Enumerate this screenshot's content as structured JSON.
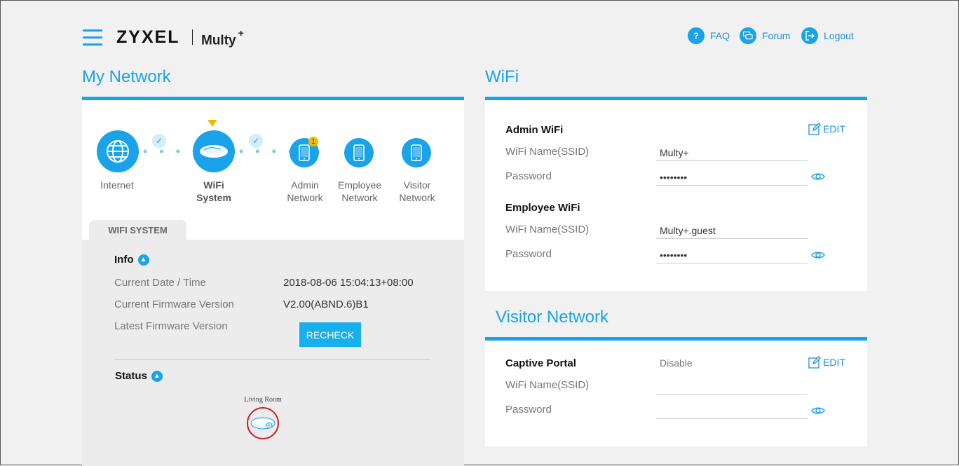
{
  "header": {
    "brand": "ZYXEL",
    "product": "Multy",
    "product_sup": "+",
    "links": [
      {
        "label": "FAQ",
        "icon": "faq-icon"
      },
      {
        "label": "Forum",
        "icon": "forum-icon"
      },
      {
        "label": "Logout",
        "icon": "logout-icon"
      }
    ]
  },
  "my_network": {
    "title": "My Network",
    "nodes": {
      "internet": "Internet",
      "wifi_system_line1": "WiFi",
      "wifi_system_line2": "System",
      "admin_line1": "Admin",
      "admin_line2": "Network",
      "admin_badge": "1",
      "employee_line1": "Employee",
      "employee_line2": "Network",
      "visitor_line1": "Visitor",
      "visitor_line2": "Network"
    },
    "tab": "WIFI SYSTEM",
    "info": {
      "heading": "Info",
      "date_label": "Current Date / Time",
      "date_value": "2018-08-06 15:04:13+08:00",
      "fw_label": "Current Firmware Version",
      "fw_value": "V2.00(ABND.6)B1",
      "latest_label": "Latest Firmware Version",
      "recheck": "RECHECK"
    },
    "status": {
      "heading": "Status",
      "device_label": "Living Room"
    }
  },
  "wifi": {
    "title": "WiFi",
    "edit": "EDIT",
    "admin": {
      "heading": "Admin WiFi",
      "ssid_label": "WiFi Name(SSID)",
      "ssid_value": "Multy+",
      "pw_label": "Password",
      "pw_value": "••••••••"
    },
    "employee": {
      "heading": "Employee WiFi",
      "ssid_label": "WiFi Name(SSID)",
      "ssid_value": "Multy+.guest",
      "pw_label": "Password",
      "pw_value": "••••••••"
    }
  },
  "visitor": {
    "title": "Visitor Network",
    "edit": "EDIT",
    "portal_label": "Captive Portal",
    "portal_value": "Disable",
    "ssid_label": "WiFi Name(SSID)",
    "ssid_value": "",
    "pw_label": "Password",
    "pw_value": ""
  },
  "colors": {
    "accent": "#1aa3e8",
    "badge": "#f5b800",
    "status_ring": "#d0202a"
  }
}
